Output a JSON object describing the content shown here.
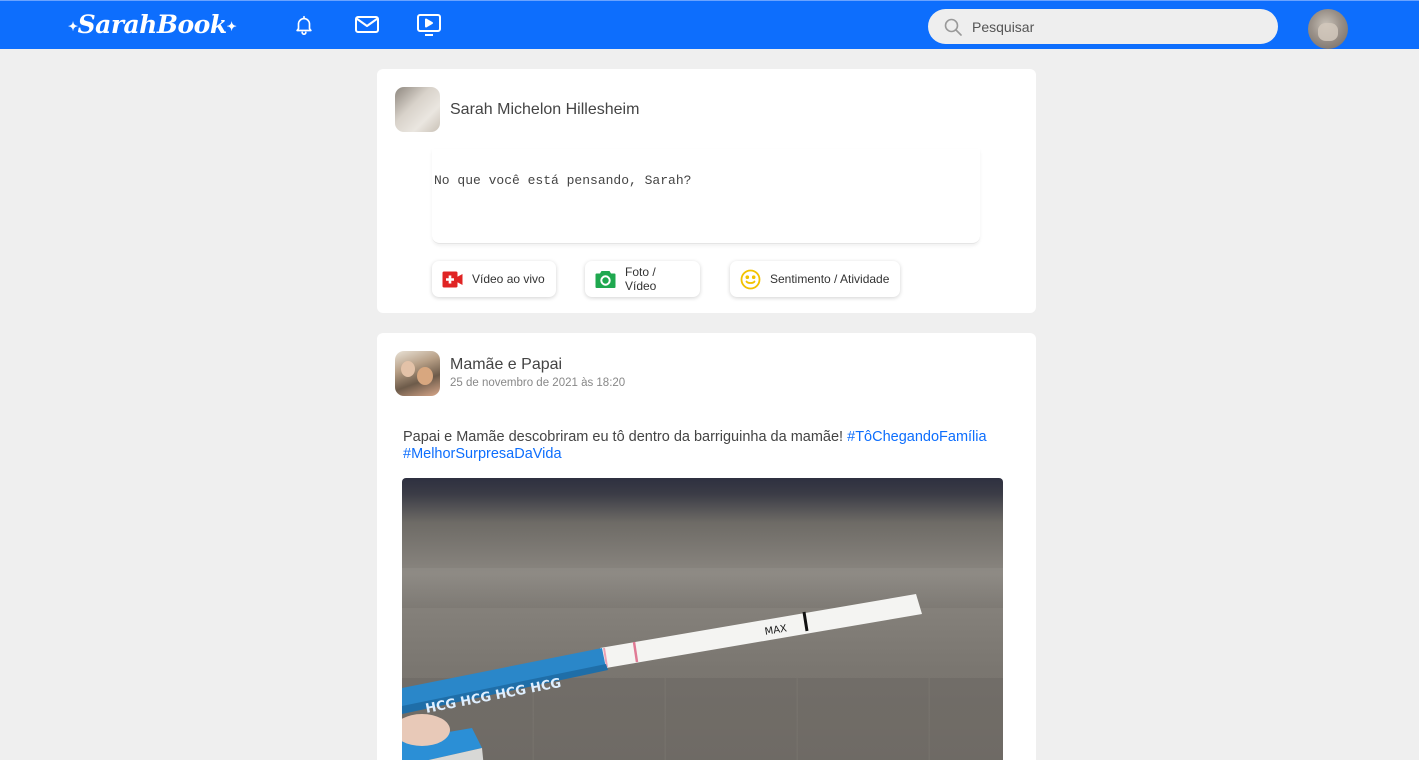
{
  "app": {
    "logo": "SarahBook",
    "logo_spark": "✦",
    "colors": {
      "brand": "#0d6efd",
      "hashtag": "#0d6efd",
      "background": "#efefef"
    }
  },
  "nav": {
    "icons": [
      "bell-icon",
      "mail-icon",
      "video-play-icon"
    ]
  },
  "search": {
    "placeholder": "Pesquisar"
  },
  "composer": {
    "author": "Sarah Michelon Hillesheim",
    "placeholder": "No que você está pensando, Sarah?",
    "actions": [
      {
        "label": "Vídeo ao vivo",
        "icon": "live-video-icon",
        "color": "#e02424"
      },
      {
        "label": "Foto / Vídeo",
        "icon": "camera-icon",
        "color": "#1fa84f"
      },
      {
        "label": "Sentimento / Atividade",
        "icon": "smiley-icon",
        "color": "#f2c200"
      }
    ]
  },
  "post": {
    "author": "Mamãe e Papai",
    "timestamp": "25 de novembro de 2021 às 18:20",
    "text": "Papai e Mamãe descobriram eu tô dentro da barriguinha da mamãe! ",
    "hashtags": [
      "#TôChegandoFamília",
      "#MelhorSurpresaDaVida"
    ],
    "image": {
      "strip_text": "HCG HCG HCG HCG",
      "max_label": "MAX"
    }
  }
}
